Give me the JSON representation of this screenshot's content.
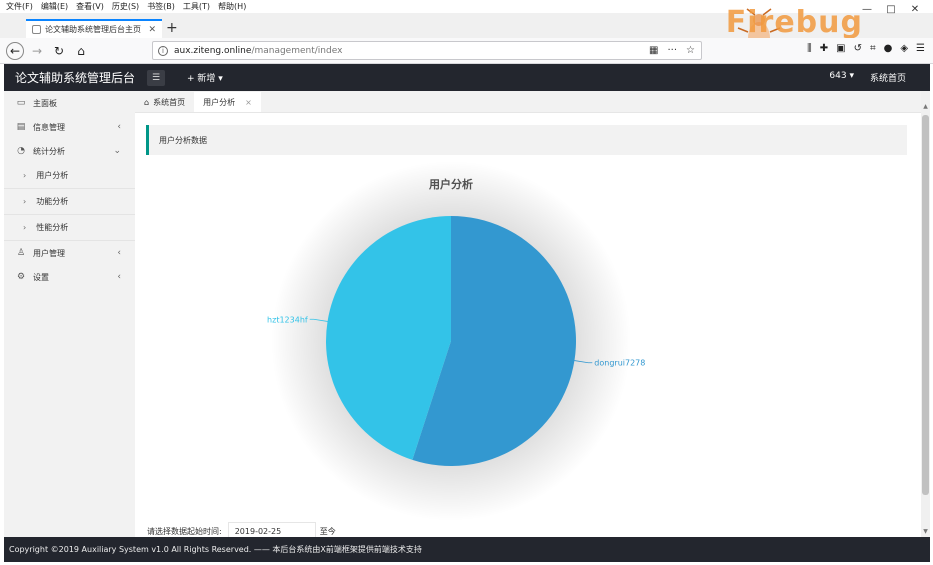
{
  "browser": {
    "menu": [
      "文件(F)",
      "编辑(E)",
      "查看(V)",
      "历史(S)",
      "书签(B)",
      "工具(T)",
      "帮助(H)"
    ],
    "tab_title": "论文辅助系统管理后台主页",
    "new_tab": "+",
    "url_host": "aux.ziteng.online",
    "url_path": "/management/index",
    "firebug_logo": "Firebug",
    "win_controls": [
      "—",
      "□",
      "✕"
    ]
  },
  "header": {
    "title": "论文辅助系统管理后台",
    "add_new": "+ 新增 ▾",
    "user": "643 ▾",
    "home_link": "系统首页"
  },
  "sidebar": {
    "items": [
      {
        "label": "主面板",
        "icon": "monitor-icon",
        "glyph": "▭",
        "arrow": ""
      },
      {
        "label": "信息管理",
        "icon": "list-icon",
        "glyph": "▤",
        "arrow": "‹"
      },
      {
        "label": "统计分析",
        "icon": "chart-icon",
        "glyph": "◔",
        "arrow": "⌄"
      }
    ],
    "sub_items": [
      "用户分析",
      "功能分析",
      "性能分析"
    ],
    "items_after": [
      {
        "label": "用户管理",
        "icon": "user-icon",
        "glyph": "♙",
        "arrow": "‹"
      },
      {
        "label": "设置",
        "icon": "gear-icon",
        "glyph": "⚙",
        "arrow": "‹"
      }
    ]
  },
  "content": {
    "tabs": {
      "home": "系统首页",
      "active": "用户分析",
      "close": "×"
    },
    "section_title": "用户分析数据",
    "date_label": "请选择数据起始时间:",
    "date_value": "2019-02-25",
    "date_suffix": "至今"
  },
  "chart_data": {
    "type": "pie",
    "title": "用户分析",
    "slices": [
      {
        "label": "dongrui7278",
        "value": 55,
        "color": "#3398d0"
      },
      {
        "label": "hzt1234hf",
        "value": 45,
        "color": "#33c3e8"
      }
    ]
  },
  "footer": {
    "text": "Copyright ©2019 Auxiliary System v1.0 All Rights Reserved. —— 本后台系统由X前端框架提供前端技术支持"
  }
}
